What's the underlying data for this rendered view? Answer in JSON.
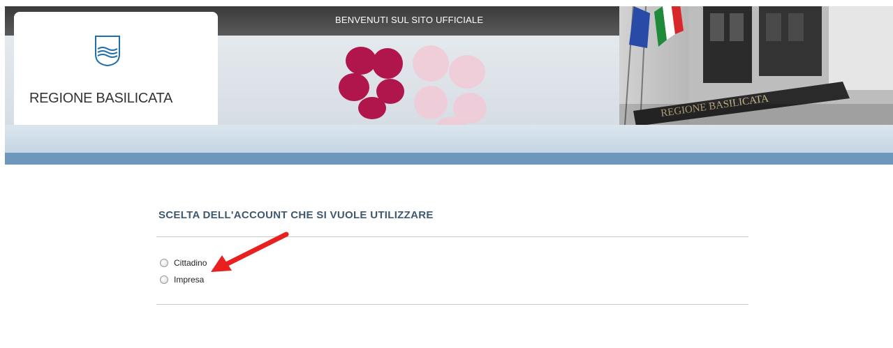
{
  "header": {
    "welcome_text": "BENVENUTI SUL SITO UFFICIALE",
    "logo_title": "REGIONE BASILICATA",
    "building_sign": "REGIONE BASILICATA"
  },
  "form": {
    "title": "SCELTA DELL'ACCOUNT CHE SI VUOLE UTILIZZARE",
    "options": [
      {
        "label": "Cittadino",
        "selected": false
      },
      {
        "label": "Impresa",
        "selected": false
      }
    ]
  },
  "colors": {
    "title": "#3e5870",
    "band": "#6d97bb",
    "flower": "#b0154c",
    "arrow": "#e8201f"
  }
}
